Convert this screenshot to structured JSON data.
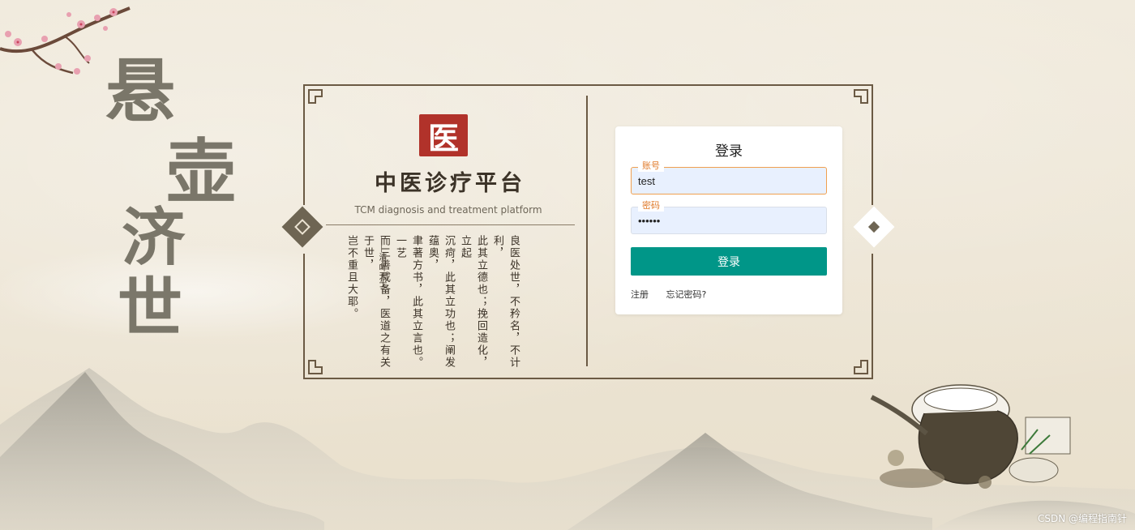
{
  "calligraphy": [
    "悬",
    "壶",
    "济",
    "世"
  ],
  "platform": {
    "seal_char": "医",
    "title": "中医诊疗平台",
    "subtitle": "TCM diagnosis and treatment platform",
    "poem_columns": [
      "良医处世，不矜名，不计利，",
      "此其立德也；挽回造化，立起",
      "沉疴，此其立功也；阐发蕴奥，",
      "聿著方书，此其立言也。一艺",
      "而三善咸备，医道之有关于世，",
      "岂不重且大耶。"
    ],
    "author": "——清·叶天士"
  },
  "login": {
    "title": "登录",
    "account_label": "账号",
    "account_value": "test",
    "password_label": "密码",
    "password_value": "••••••",
    "submit_label": "登录",
    "register_link": "注册",
    "forgot_link": "忘记密码?"
  },
  "watermark": "CSDN @编程指南针",
  "colors": {
    "primary": "#009688",
    "seal": "#b1322a",
    "frame": "#6b5a44",
    "focus_border": "#f0a050"
  }
}
